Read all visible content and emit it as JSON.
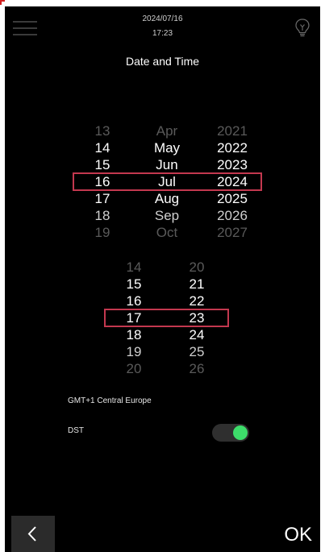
{
  "status": {
    "date": "2024/07/16",
    "time": "17:23"
  },
  "page": {
    "title": "Date and Time"
  },
  "date_picker": {
    "day": [
      "13",
      "14",
      "15",
      "16",
      "17",
      "18",
      "19"
    ],
    "month": [
      "Apr",
      "May",
      "Jun",
      "Jul",
      "Aug",
      "Sep",
      "Oct"
    ],
    "year": [
      "2021",
      "2022",
      "2023",
      "2024",
      "2025",
      "2026",
      "2027"
    ],
    "selected": {
      "day": "16",
      "month": "Jul",
      "year": "2024"
    }
  },
  "time_picker": {
    "hour": [
      "14",
      "15",
      "16",
      "17",
      "18",
      "19",
      "20"
    ],
    "minute": [
      "20",
      "21",
      "22",
      "23",
      "24",
      "25",
      "26"
    ],
    "selected": {
      "hour": "17",
      "minute": "23"
    }
  },
  "settings": {
    "timezone": "GMT+1 Central Europe",
    "dst_label": "DST",
    "dst_enabled": true
  },
  "footer": {
    "ok_label": "OK"
  },
  "colors": {
    "background": "#000000",
    "selection": "#c3384f",
    "toggle_on": "#3ddc6a"
  },
  "icons": {
    "menu": "menu-icon",
    "bulb": "lightbulb-icon",
    "back": "chevron-left-icon"
  }
}
